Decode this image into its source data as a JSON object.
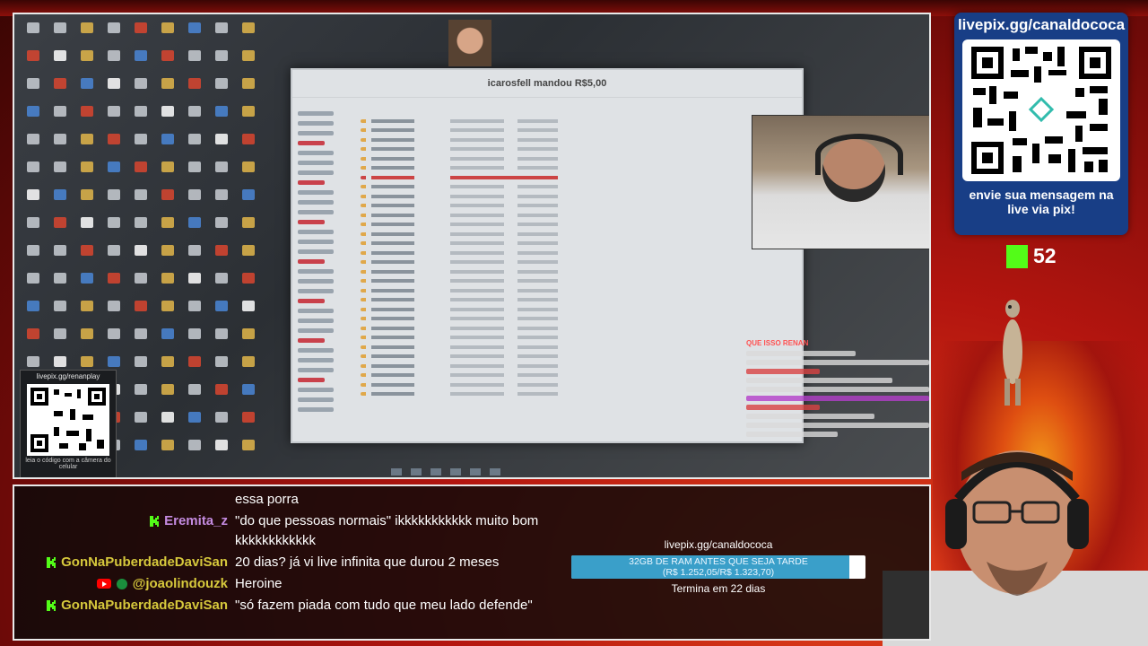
{
  "screen": {
    "explorer_title": "icarosfell mandou R$5,00",
    "inner_chat_header": "QUE ISSO RENAN",
    "small_qr_caption": "livepix.gg/renanplay",
    "small_qr_hint": "leia o código com a câmera do celular"
  },
  "qr_panel": {
    "url": "livepix.gg/canaldococa",
    "message_line1": "envie sua mensagem na",
    "message_line2": "live via pix!"
  },
  "kick": {
    "viewers": "52",
    "color": "#53fc18"
  },
  "chat": {
    "messages": [
      {
        "platform": "",
        "user": "",
        "text": "essa porra"
      },
      {
        "platform": "kick",
        "user": "Eremita_z",
        "text": "\"do que pessoas normais\" ikkkkkkkkkkk muito bom kkkkkkkkkkkk"
      },
      {
        "platform": "kick",
        "user": "GonNaPuberdadeDaviSan",
        "text": "20 dias? já vi live infinita que durou 2 meses"
      },
      {
        "platform": "youtube",
        "user": "@joaolindouzk",
        "text": "Heroine"
      },
      {
        "platform": "kick",
        "user": "GonNaPuberdadeDaviSan",
        "text": "\"só fazem piada com tudo que meu lado defende\""
      }
    ]
  },
  "goal": {
    "url": "livepix.gg/canaldococa",
    "title": "32GB DE RAM ANTES QUE SEJA TARDE",
    "amounts": "(R$ 1.252,05/R$ 1.323,70)",
    "progress": 0.946,
    "ends": "Termina em 22 dias",
    "fill_color": "#3a9fc9"
  }
}
